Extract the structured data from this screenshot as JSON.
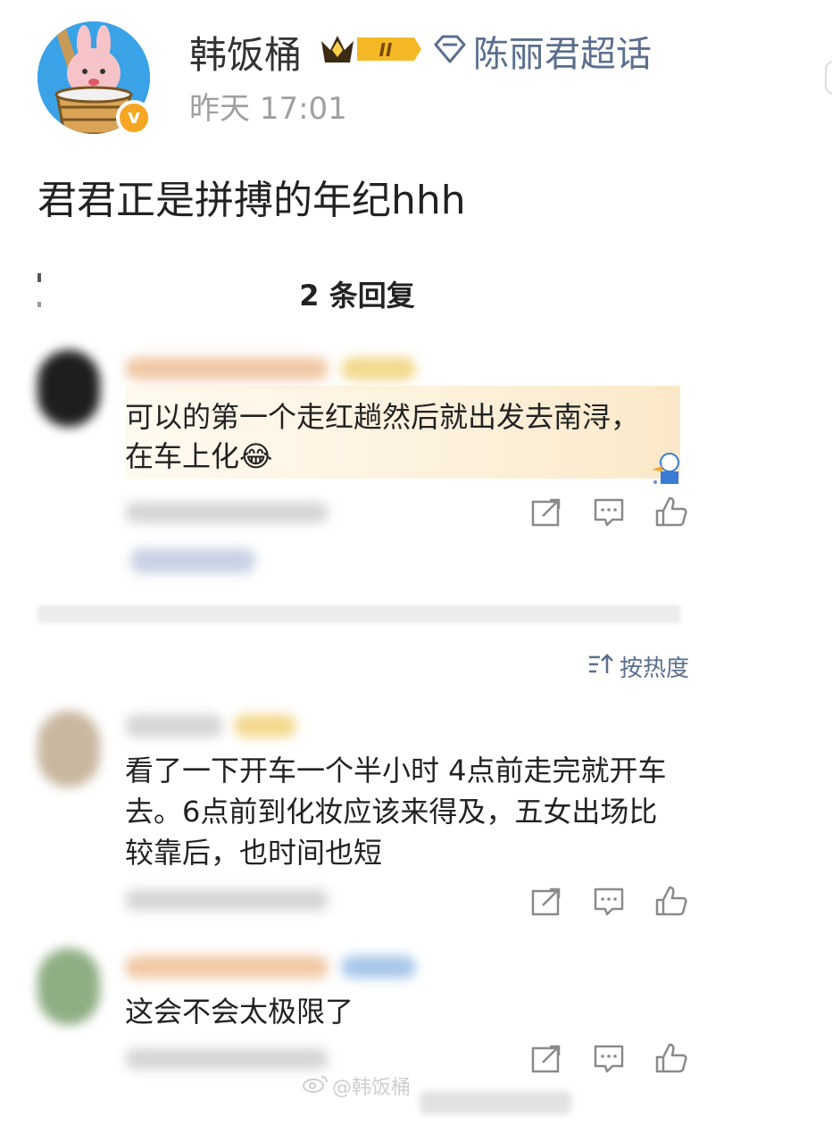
{
  "post": {
    "author": "韩饭桶",
    "fan_badge_level": "II",
    "supertopic": "陈丽君超话",
    "time": "昨天 17:01",
    "text": "君君正是拼搏的年纪hhh"
  },
  "replies_header": "2 条回复",
  "reply": {
    "text_line1": "可以的第一个走红趟然后就出发去南浔，",
    "text_line2": "在车上化😂"
  },
  "sort": {
    "label": "按热度"
  },
  "comments": [
    {
      "line1": "看了一下开车一个半小时 4点前走完就开车",
      "line2": "去。6点前到化妆应该来得及，五女出场比",
      "line3": "较靠后，也时间也短"
    },
    {
      "line1": "这会不会太极限了"
    }
  ],
  "watermark": "@韩饭桶",
  "icons": {
    "repost": "share-icon",
    "comment": "comment-icon",
    "like": "thumbs-up-icon",
    "verified": "verified-badge-icon",
    "supertopic": "diamond-icon",
    "sort": "sort-icon"
  },
  "colors": {
    "link": "#5b6f8e",
    "badge": "#f6a623",
    "time": "#a0a0a0"
  }
}
